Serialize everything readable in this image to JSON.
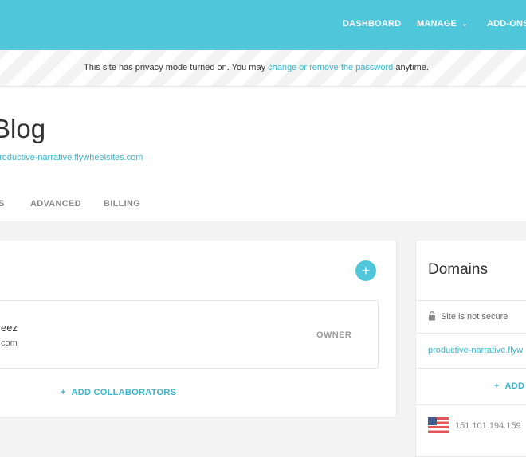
{
  "nav": {
    "dashboard": "DASHBOARD",
    "manage": "MANAGE",
    "addons": "ADD-ONS"
  },
  "privacy_banner": {
    "text_before": "This site has privacy mode turned on. You may ",
    "link": "change or remove the password",
    "text_after": " anytime."
  },
  "site": {
    "title": "Blog",
    "subdomain": "productive-narrative.flywheelsites.com"
  },
  "tabs": [
    {
      "label": "S"
    },
    {
      "label": "ADVANCED"
    },
    {
      "label": "BILLING"
    }
  ],
  "collaborators": {
    "add_icon": "+",
    "rows": [
      {
        "name": "eez",
        "email": "com",
        "role": "OWNER"
      }
    ],
    "add_label": "ADD COLLABORATORS",
    "add_prefix": "+"
  },
  "domains": {
    "title": "Domains",
    "security_status": "Site is not secure",
    "domain": "productive-narrative.flyw",
    "add_prefix": "+",
    "add_label": "ADD",
    "ip": "151.101.194.159",
    "flag_icon": "us-flag-icon"
  },
  "colors": {
    "brand": "#50c6db",
    "link": "#39b5cc"
  }
}
